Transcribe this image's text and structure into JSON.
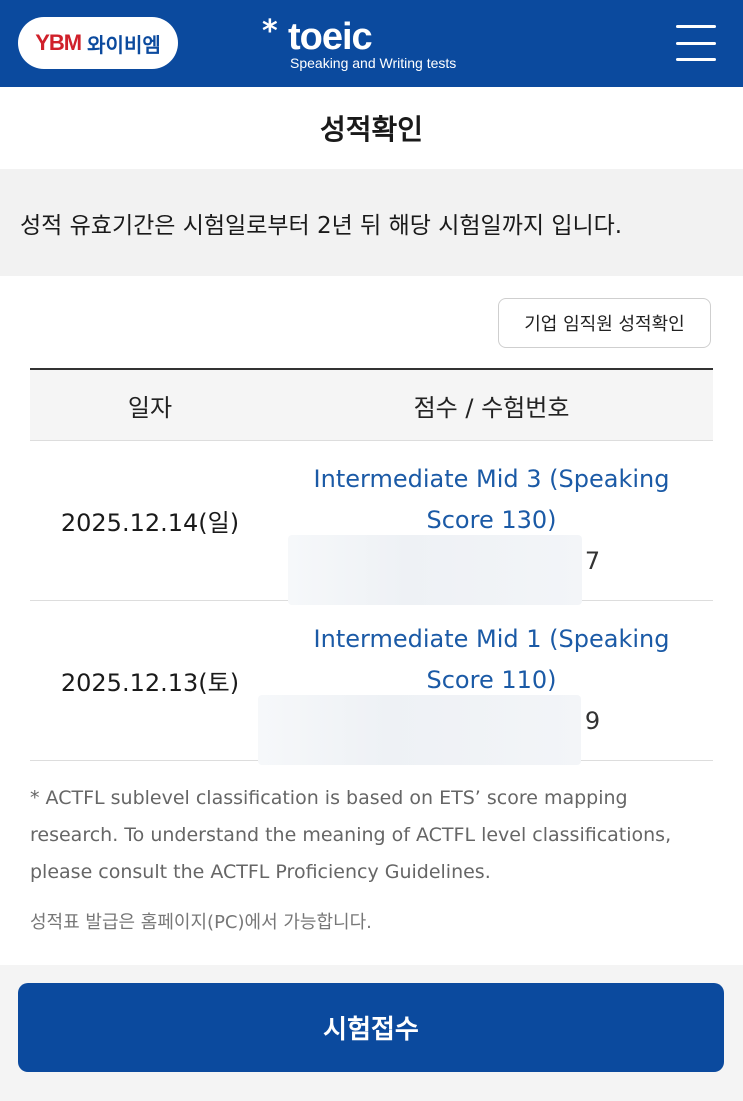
{
  "header": {
    "brand_mark": "YBM",
    "brand_name": "와이비엠",
    "logo_star": "*",
    "logo_text": "toeic",
    "logo_subtitle": "Speaking and Writing tests"
  },
  "page": {
    "title": "성적확인",
    "notice": "성적 유효기간은 시험일로부터 2년 뒤 해당 시험일까지 입니다.",
    "corp_button_label": "기업 임직원 성적확인"
  },
  "table": {
    "columns": [
      "일자",
      "점수 / 수험번호"
    ],
    "rows": [
      {
        "date": "2025.12.14(일)",
        "score": "Intermediate Mid 3 (Speaking Score 130)",
        "exam_no_tail": "7"
      },
      {
        "date": "2025.12.13(토)",
        "score": "Intermediate Mid 1 (Speaking Score 110)",
        "exam_no_tail": "9"
      }
    ]
  },
  "footnote": "* ACTFL sublevel classification is based on ETS’ score mapping research. To understand the meaning of ACTFL level classifications, please consult the ACTFL Proficiency Guidelines.",
  "issue_note": "성적표 발급은 홈페이지(PC)에서 가능합니다.",
  "apply_button_label": "시험접수",
  "colors": {
    "brand_blue": "#0b4a9e",
    "link_blue": "#1b5aa6",
    "ybm_red": "#d0202a"
  },
  "icons": {
    "menu": "hamburger-menu-icon"
  }
}
